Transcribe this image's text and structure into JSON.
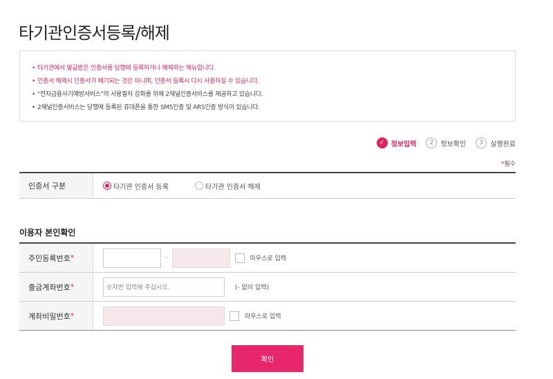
{
  "page": {
    "title": "타기관인증서등록/해제"
  },
  "notice": {
    "lines": [
      {
        "bullet": "•",
        "text": "타기관에서 발급받은 인증서를 당행에 등록하거나 해제하는 메뉴입니다.",
        "highlight": true
      },
      {
        "bullet": "•",
        "text": "인증서 해제시 인증서가 폐기되는 것은 아니며, 인증서 등록시 다시 사용하실 수 있습니다.",
        "highlight": true
      },
      {
        "bullet": "•",
        "text": "\"전자금융사기예방서비스\"의 사용절차 강화를 위해 2채널인증서비스를 제공하고 있습니다.",
        "highlight": false
      },
      {
        "bullet": "•",
        "text": "2채널인증서비스는 당행에 등록된 휴대폰을 통한 SMS인증 및 ARS인증 방식이 있습니다.",
        "highlight": false
      }
    ]
  },
  "steps": [
    {
      "number": "✓",
      "label": "정보입력",
      "active": true
    },
    {
      "number": "2",
      "label": "정보확인",
      "active": false
    },
    {
      "number": "3",
      "label": "실행완료",
      "active": false
    }
  ],
  "required_note": {
    "star": "*",
    "text": "필수"
  },
  "cert_type": {
    "label": "인증서 구분",
    "options": [
      {
        "label": "타기관 인증서 등록",
        "checked": true
      },
      {
        "label": "타기관 인증서 해제",
        "checked": false
      }
    ]
  },
  "identity": {
    "title": "이용자 본인확인",
    "resident": {
      "label": "주민등록번호",
      "star": "*",
      "dash": "-",
      "mouse_input": "마우스로 입력"
    },
    "account": {
      "label": "출금계좌번호",
      "star": "*",
      "placeholder": "숫자만 입력해 주십시오.",
      "hint": "(- 없이 입력)"
    },
    "password": {
      "label": "계좌비밀번호",
      "star": "*",
      "mouse_input": "마우스로 입력"
    }
  },
  "confirm_button": "확인",
  "colors": {
    "accent": "#e0245e",
    "button": "#e8266b",
    "filled_input": "#f6e8ea"
  }
}
